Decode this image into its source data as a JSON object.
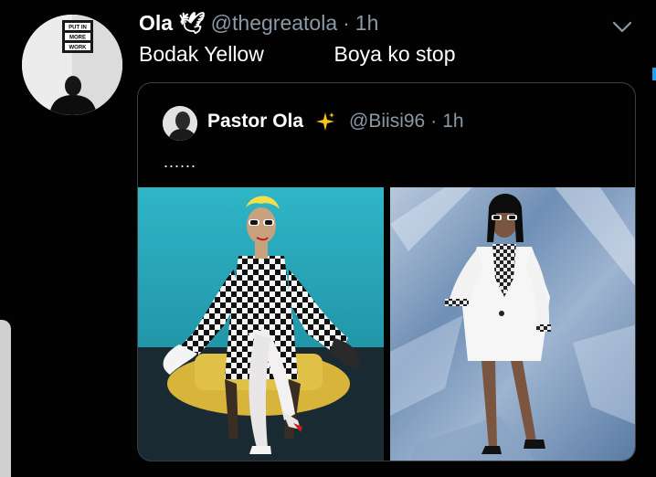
{
  "tweet": {
    "name": "Ola 🕊",
    "handle": "@thegreatola",
    "separator": "·",
    "time": "1h",
    "text": "Bodak Yellow            Boya ko stop"
  },
  "quoted_tweet": {
    "name": "Pastor Ola",
    "handle": "@Biisi96",
    "separator": "·",
    "time": "1h",
    "text": "......"
  },
  "avatar_sign": {
    "line1": "PUT IN",
    "line2": "MORE",
    "line3": "WORK"
  },
  "icons": {
    "chevron": "chevron-down-icon",
    "sparkle": "sparkles-icon"
  },
  "colors": {
    "background": "#020202",
    "secondary_text": "#8b98a5",
    "border": "#3a3f45",
    "accent": "#1da1f2",
    "sparkle": "#f5c518"
  }
}
